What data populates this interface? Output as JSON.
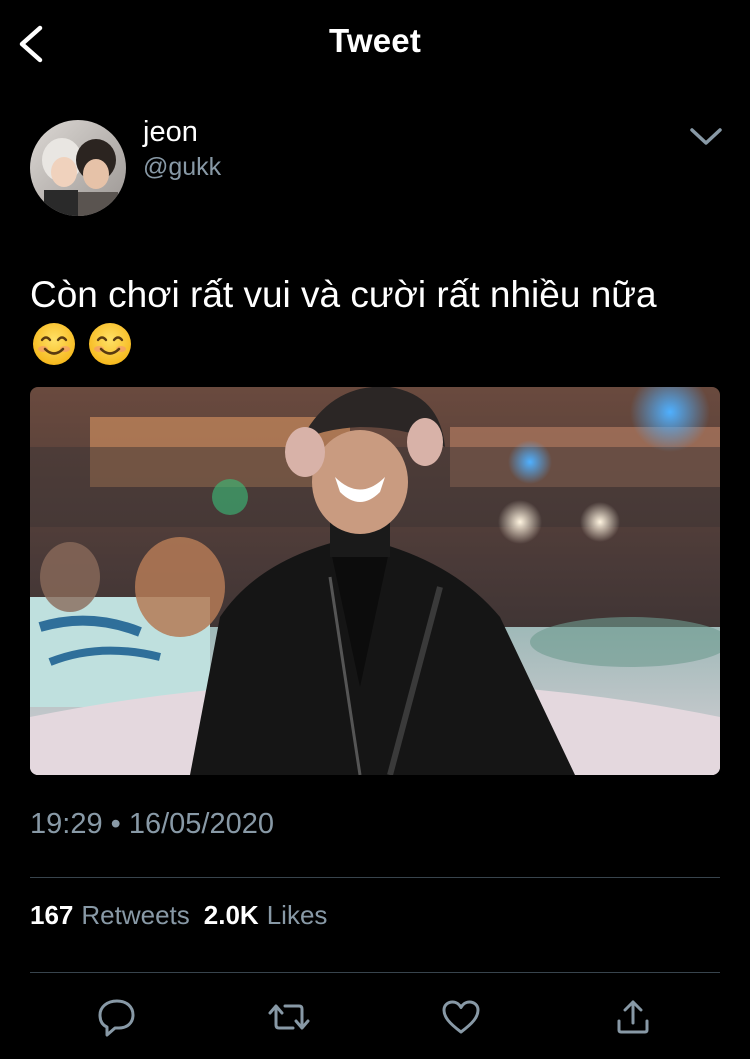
{
  "header": {
    "title": "Tweet",
    "back_icon": "back-chevron-icon"
  },
  "author": {
    "name": "jeon",
    "handle": "@gukk",
    "menu_icon": "chevron-down-icon"
  },
  "tweet": {
    "text": "Còn chơi rất vui và cười rất nhiều nữa",
    "emojis": [
      "smiling-face-icon",
      "smiling-face-icon"
    ],
    "timestamp": "19:29 • 16/05/2020"
  },
  "stats": {
    "retweets_count": "167",
    "retweets_label": "Retweets",
    "likes_count": "2.0K",
    "likes_label": "Likes"
  },
  "actions": {
    "icons": [
      "reply-icon",
      "retweet-icon",
      "like-icon",
      "share-icon"
    ]
  },
  "colors": {
    "background": "#000000",
    "text_primary": "#ffffff",
    "text_secondary": "#8899a6",
    "divider": "#38444d"
  }
}
